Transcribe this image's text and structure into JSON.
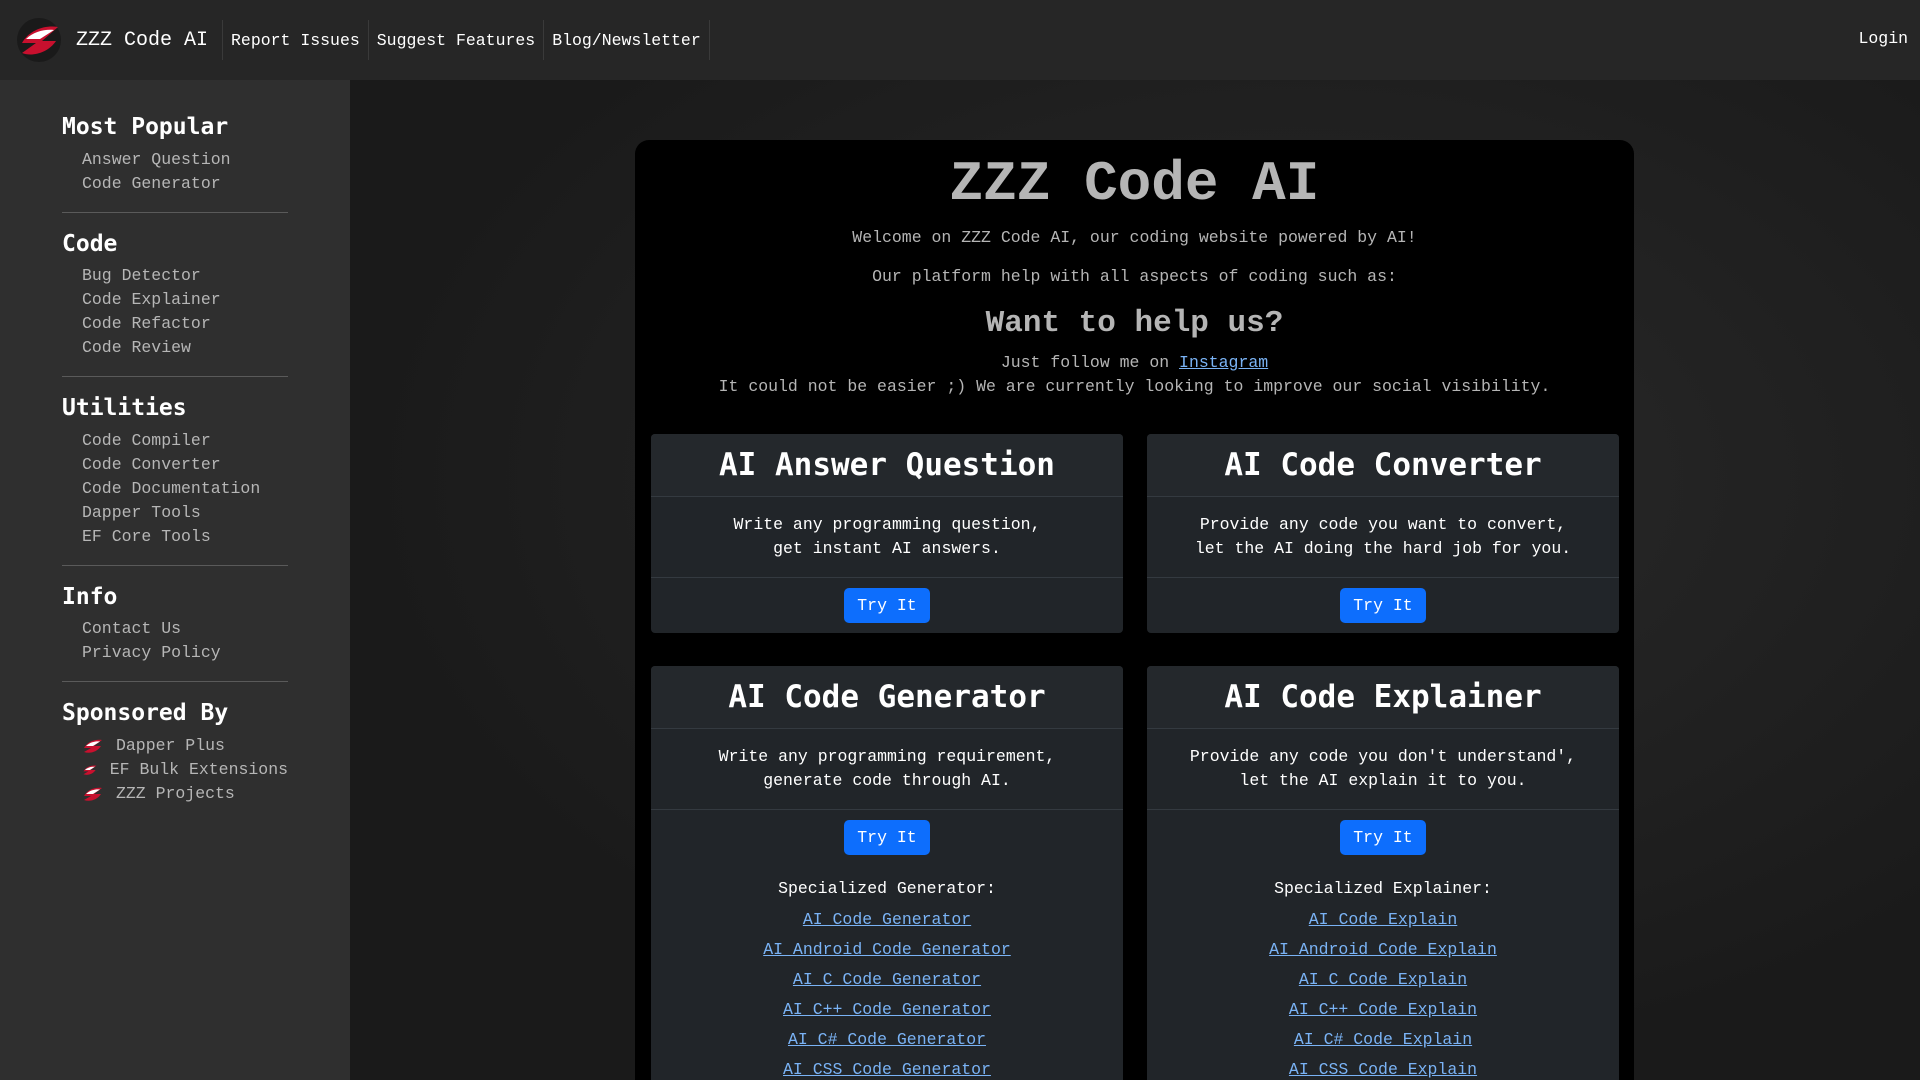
{
  "navbar": {
    "brand": "ZZZ Code AI",
    "links": [
      "Report Issues",
      "Suggest Features",
      "Blog/Newsletter"
    ],
    "login": "Login"
  },
  "sidebar": {
    "sections": [
      {
        "title": "Most Popular",
        "items": [
          "Answer Question",
          "Code Generator"
        ]
      },
      {
        "title": "Code",
        "items": [
          "Bug Detector",
          "Code Explainer",
          "Code Refactor",
          "Code Review"
        ]
      },
      {
        "title": "Utilities",
        "items": [
          "Code Compiler",
          "Code Converter",
          "Code Documentation",
          "Dapper Tools",
          "EF Core Tools"
        ]
      },
      {
        "title": "Info",
        "items": [
          "Contact Us",
          "Privacy Policy"
        ]
      },
      {
        "title": "Sponsored By",
        "items": [
          "Dapper Plus",
          "EF Bulk Extensions",
          "ZZZ Projects"
        ]
      }
    ]
  },
  "hero": {
    "title": "ZZZ Code AI",
    "welcome": "Welcome on ZZZ Code AI, our coding website powered by AI!",
    "platform": "Our platform help with all aspects of coding such as:",
    "help_title": "Want to help us?",
    "follow_prefix": "Just follow me on ",
    "follow_link": "Instagram",
    "follow_line2": "It could not be easier ;) We are currently looking to improve our social visibility."
  },
  "cards": [
    {
      "title": "AI Answer Question",
      "line1": "Write any programming question,",
      "line2": "get instant AI answers.",
      "button": "Try It"
    },
    {
      "title": "AI Code Converter",
      "line1": "Provide any code you want to convert,",
      "line2": "let the AI doing the hard job for you.",
      "button": "Try It"
    },
    {
      "title": "AI Code Generator",
      "line1": "Write any programming requirement,",
      "line2": "generate code through AI.",
      "button": "Try It",
      "special_title": "Specialized Generator:",
      "special": [
        "AI Code Generator",
        "AI Android Code Generator",
        "AI C Code Generator",
        "AI C++ Code Generator",
        "AI C# Code Generator",
        "AI CSS Code Generator"
      ]
    },
    {
      "title": "AI Code Explainer",
      "line1": "Provide any code you don't understand',",
      "line2": "let the AI explain it to you.",
      "button": "Try It",
      "special_title": "Specialized Explainer:",
      "special": [
        "AI Code Explain",
        "AI Android Code Explain",
        "AI C Code Explain",
        "AI C++ Code Explain",
        "AI C# Code Explain",
        "AI CSS Code Explain"
      ]
    }
  ],
  "colors": {
    "accent": "#0d6efd",
    "link": "#7ab3f5",
    "logo_red": "#c8102e"
  }
}
